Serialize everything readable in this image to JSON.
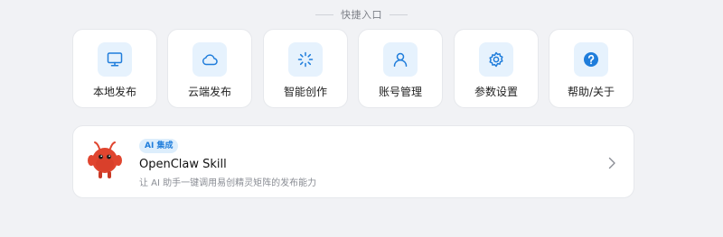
{
  "header": {
    "title": "快捷入口"
  },
  "quick_entries": [
    {
      "label": "本地发布",
      "icon": "monitor-icon"
    },
    {
      "label": "云端发布",
      "icon": "cloud-icon"
    },
    {
      "label": "智能创作",
      "icon": "sparkle-loader-icon"
    },
    {
      "label": "账号管理",
      "icon": "user-icon"
    },
    {
      "label": "参数设置",
      "icon": "gear-icon"
    },
    {
      "label": "帮助/关于",
      "icon": "help-circle-icon"
    }
  ],
  "skill": {
    "badge": "AI 集成",
    "title": "OpenClaw Skill",
    "description": "让 AI 助手一键调用易创精灵矩阵的发布能力",
    "mascot_icon": "red-claw-mascot-icon"
  },
  "colors": {
    "accent": "#1f7ddb",
    "icon_bg": "#e6f2fd",
    "page_bg": "#f1f2f5",
    "mascot": "#e0452f"
  }
}
